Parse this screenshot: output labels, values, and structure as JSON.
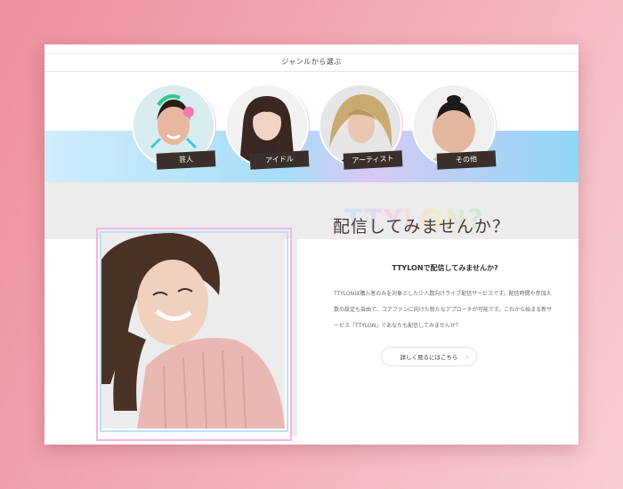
{
  "genre_section": {
    "title": "ジャンルから選ぶ",
    "items": [
      {
        "label": "芸人"
      },
      {
        "label": "アイドル"
      },
      {
        "label": "アーティスト"
      },
      {
        "label": "その他"
      }
    ]
  },
  "intro": {
    "catchphrase": "配信してみませんか？",
    "catch_bg": "TTYLON?",
    "title": "TTYLONで配信してみませんか?",
    "text": "TTYLONは購入者のみを対象とした少人数向けライブ配信サービスです。配信時間や参加人数の設定も自由で、コアファンに向けた新たなアプローチが可能です。これから始まる新サービス「TTYLON」であなたも配信してみませんか？",
    "button_label": "詳しく見るにはこちら",
    "button_icon": "chevron-right-icon"
  },
  "colors": {
    "page_bg": "#ef9eaa",
    "accent_pink": "#f6b3e6",
    "accent_blue": "#a6dcf7",
    "label_bg": "#3b2f2c"
  }
}
